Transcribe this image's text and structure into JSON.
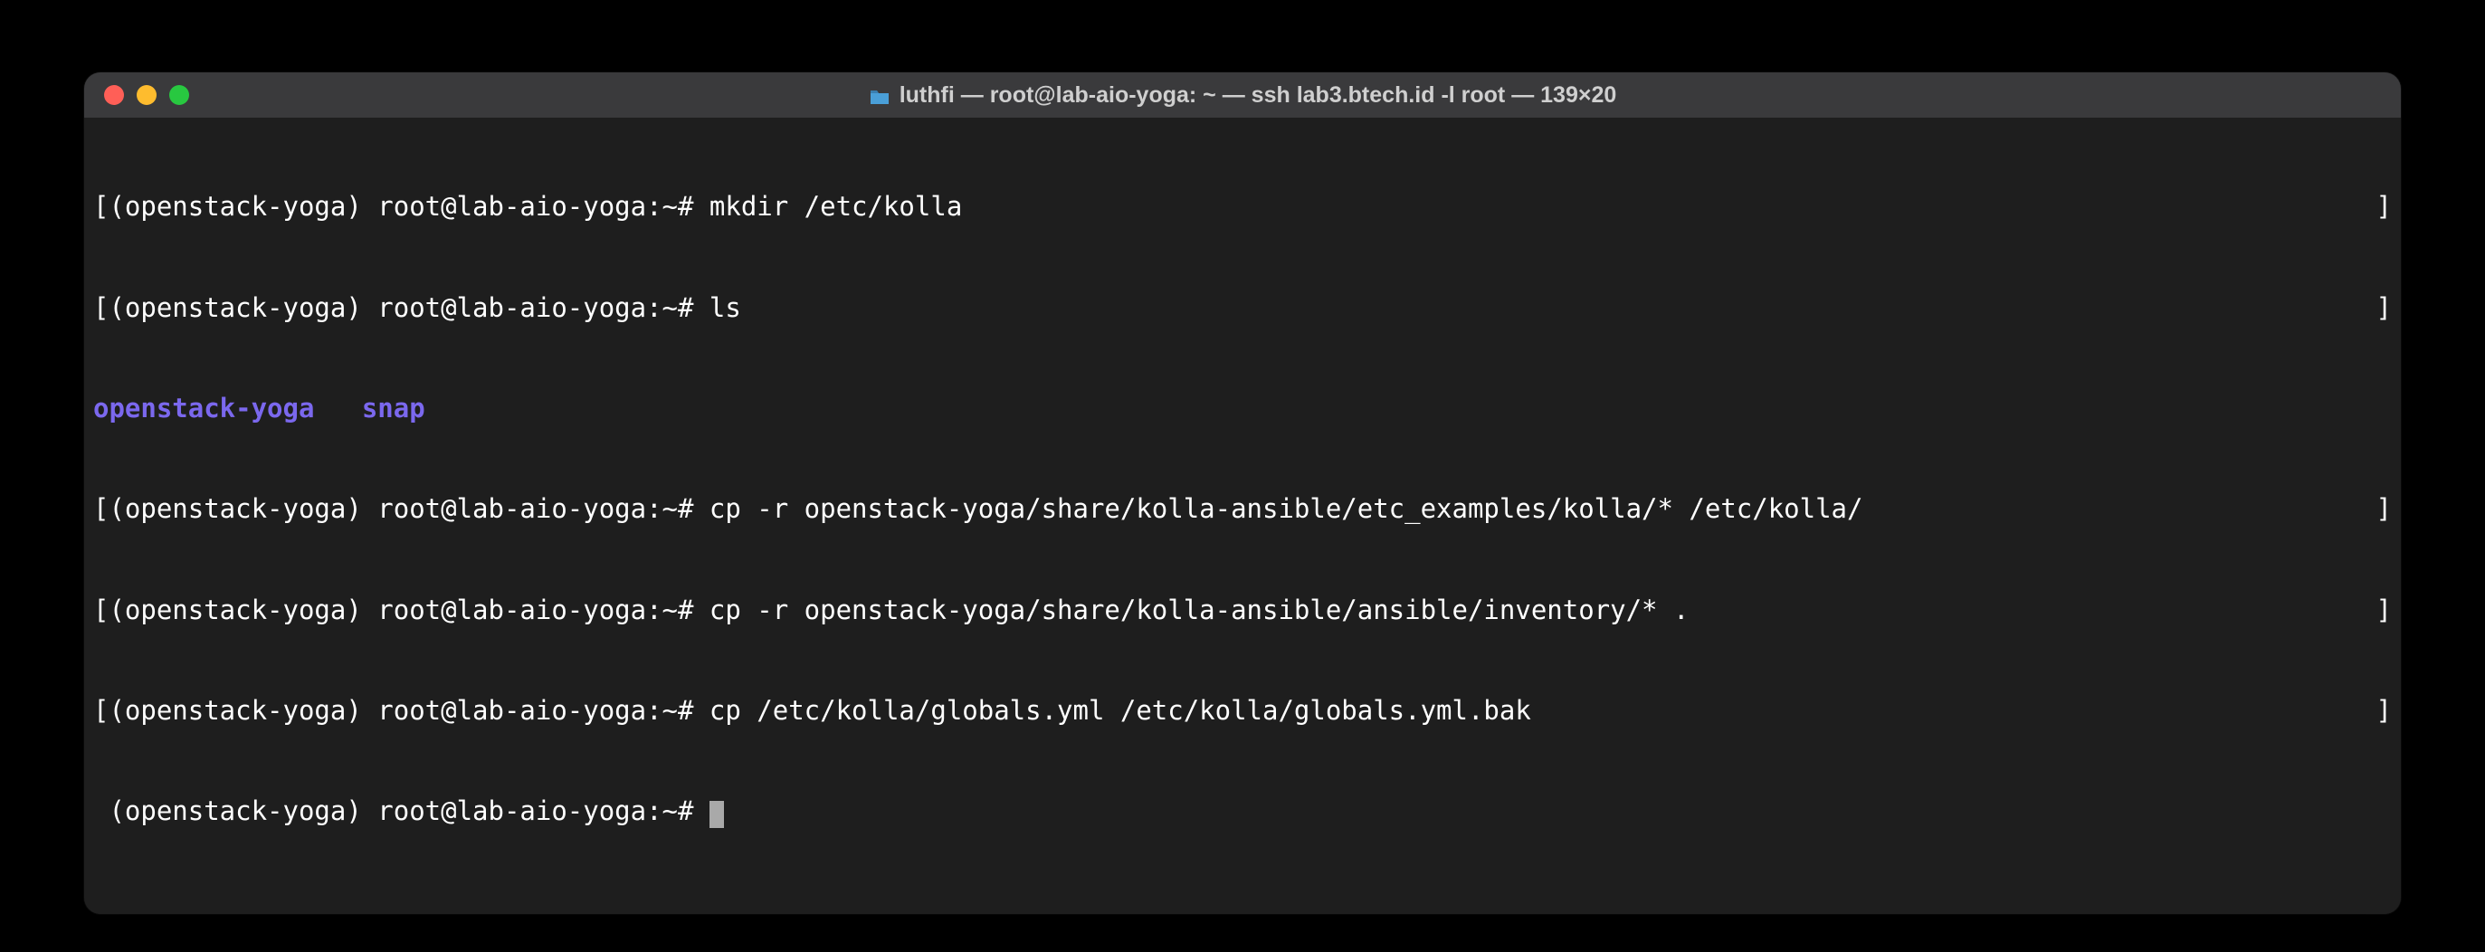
{
  "window": {
    "title": "luthfi — root@lab-aio-yoga: ~ — ssh lab3.btech.id -l root — 139×20"
  },
  "prompt": {
    "env": "(openstack-yoga)",
    "user_host": "root@lab-aio-yoga",
    "path": "~",
    "symbol": "#"
  },
  "ls_output": {
    "dir1": "openstack-yoga",
    "dir2": "snap"
  },
  "lines": [
    {
      "prefix": "[(openstack-yoga) root@lab-aio-yoga:~# ",
      "cmd": "mkdir /etc/kolla",
      "bracket": true
    },
    {
      "prefix": "[(openstack-yoga) root@lab-aio-yoga:~# ",
      "cmd": "ls",
      "bracket": true
    },
    {
      "prefix": "[(openstack-yoga) root@lab-aio-yoga:~# ",
      "cmd": "cp -r openstack-yoga/share/kolla-ansible/etc_examples/kolla/* /etc/kolla/",
      "bracket": true
    },
    {
      "prefix": "[(openstack-yoga) root@lab-aio-yoga:~# ",
      "cmd": "cp -r openstack-yoga/share/kolla-ansible/ansible/inventory/* .",
      "bracket": true
    },
    {
      "prefix": "[(openstack-yoga) root@lab-aio-yoga:~# ",
      "cmd": "cp /etc/kolla/globals.yml /etc/kolla/globals.yml.bak",
      "bracket": true
    },
    {
      "prefix": " (openstack-yoga) root@lab-aio-yoga:~# ",
      "cmd": "",
      "cursor": true,
      "bracket": false
    }
  ]
}
